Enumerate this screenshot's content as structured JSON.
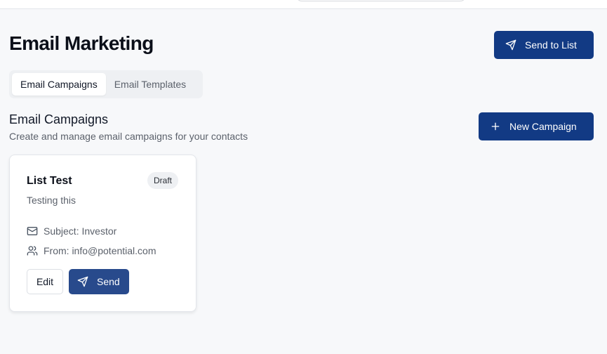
{
  "header": {
    "title": "Email Marketing",
    "send_to_list_label": "Send to List"
  },
  "tabs": [
    {
      "label": "Email Campaigns",
      "active": true
    },
    {
      "label": "Email Templates",
      "active": false
    }
  ],
  "section": {
    "title": "Email Campaigns",
    "subtitle": "Create and manage email campaigns for your contacts",
    "new_campaign_label": "New Campaign"
  },
  "campaigns": [
    {
      "name": "List Test",
      "status": "Draft",
      "description": "Testing this",
      "subject": "Subject: Investor",
      "from": "From: info@potential.com",
      "edit_label": "Edit",
      "send_label": "Send"
    }
  ],
  "icons": {
    "send": "send-icon",
    "plus": "plus-icon",
    "mail": "mail-icon",
    "users": "users-icon"
  },
  "colors": {
    "primary": "#123a84",
    "send_button": "#284a8c",
    "background": "#f7f8fa"
  }
}
